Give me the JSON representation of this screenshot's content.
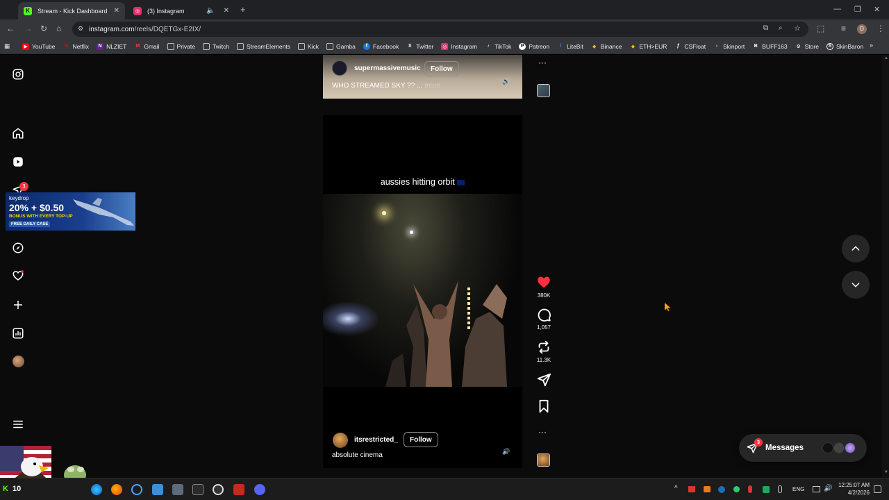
{
  "browser": {
    "tabs": [
      {
        "title": "Stream - Kick Dashboard",
        "active": true
      },
      {
        "title": "(3) Instagram",
        "active": false
      }
    ],
    "url_host": "instagram.com",
    "url_path": "/reels/DQETGx-E2IX/",
    "bookmarks": [
      "YouTube",
      "Netflix",
      "NLZIET",
      "Gmail",
      "Private",
      "Twitch",
      "StreamElements",
      "Kick",
      "Gamba",
      "Facebook",
      "Twitter",
      "Instagram",
      "TikTok",
      "Patreon",
      "LiteBit",
      "Binance",
      "ETH>EUR",
      "CSFloat",
      "Skinport",
      "BUFF163",
      "Store",
      "SkinBaron"
    ]
  },
  "sidebar": {
    "notification_count": "3"
  },
  "overlay_ad": {
    "brand": "keydrop",
    "headline": "20% + $0.50",
    "sub": "BONUS WITH EVERY TOP-UP",
    "tag": "FREE DAILY CASE"
  },
  "reel_prev": {
    "username": "supermassivemusic",
    "follow": "Follow",
    "caption": "WHO STREAMED SKY ?? ...",
    "more": "more"
  },
  "reel_main": {
    "overlay_text": "aussies hitting orbit",
    "username": "itsrestricted_",
    "follow": "Follow",
    "caption": "absolute cinema",
    "likes": "380K",
    "comments": "1,057",
    "reposts": "11.3K"
  },
  "messages": {
    "label": "Messages",
    "badge": "3"
  },
  "taskbar": {
    "kick_count": "10",
    "lang": "ENG",
    "time": "12:25:07 AM",
    "date": "4/2/2026"
  },
  "colors": {
    "like": "#ff3040",
    "kick": "#53fc18",
    "instagram": "#e1306c"
  }
}
